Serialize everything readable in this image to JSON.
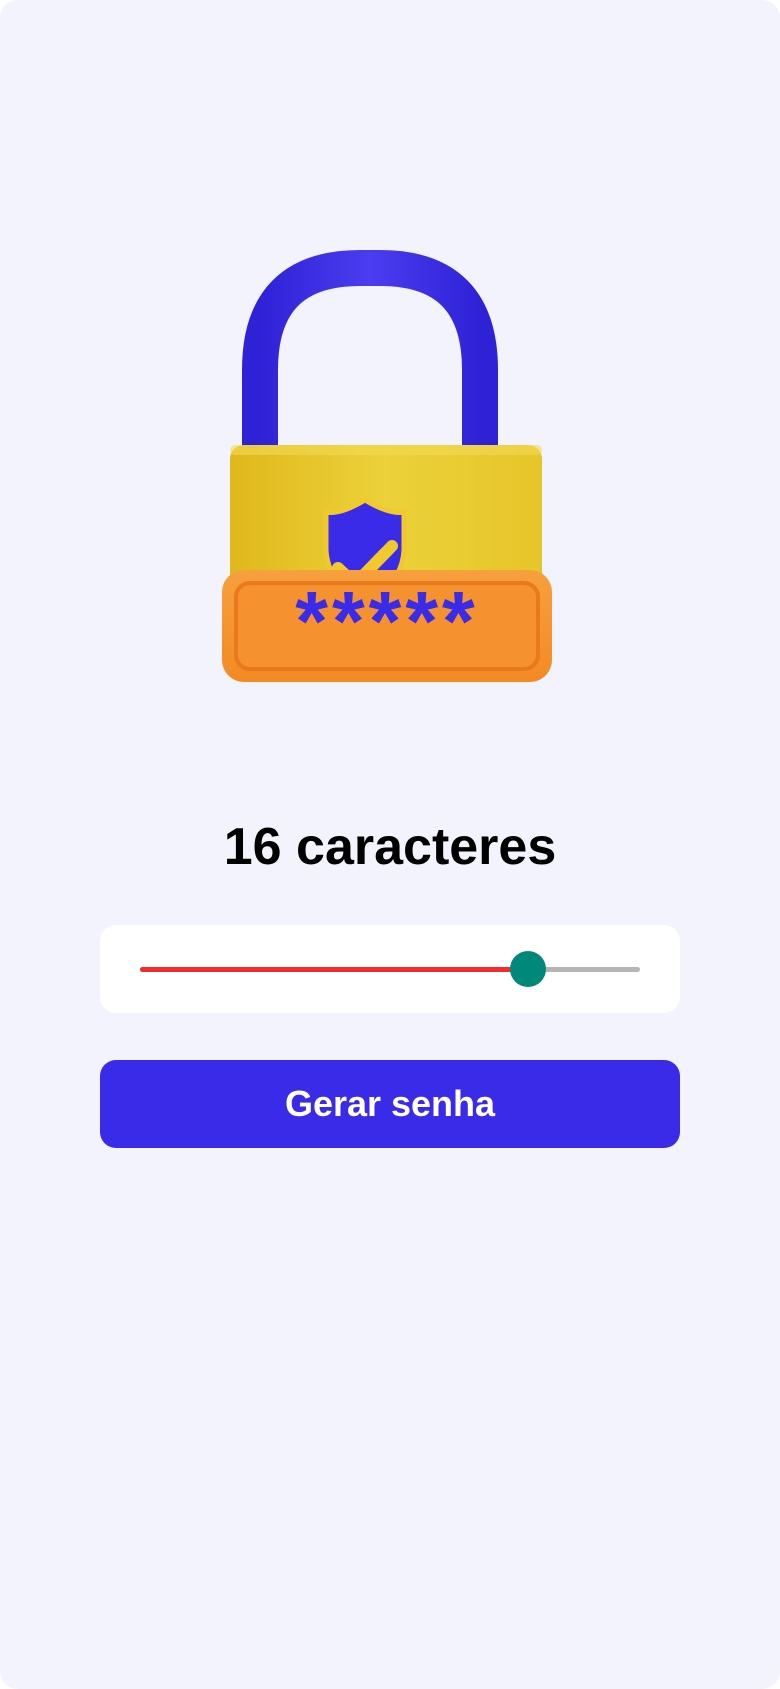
{
  "illustration": {
    "icon": "padlock-password-icon",
    "mask_text": "*****",
    "colors": {
      "shackle": "#3a2be8",
      "body": "#e8c52a",
      "plate": "#f5912e",
      "shield": "#3a2be8",
      "check": "#f2c92c"
    }
  },
  "length_title": "16 caracteres",
  "slider": {
    "value_fraction": 0.775,
    "colors": {
      "fill": "#f42b2b",
      "track": "#b5b5b5",
      "thumb": "#00897b"
    }
  },
  "generate_button": {
    "label": "Gerar senha",
    "color": "#3a2be8"
  }
}
